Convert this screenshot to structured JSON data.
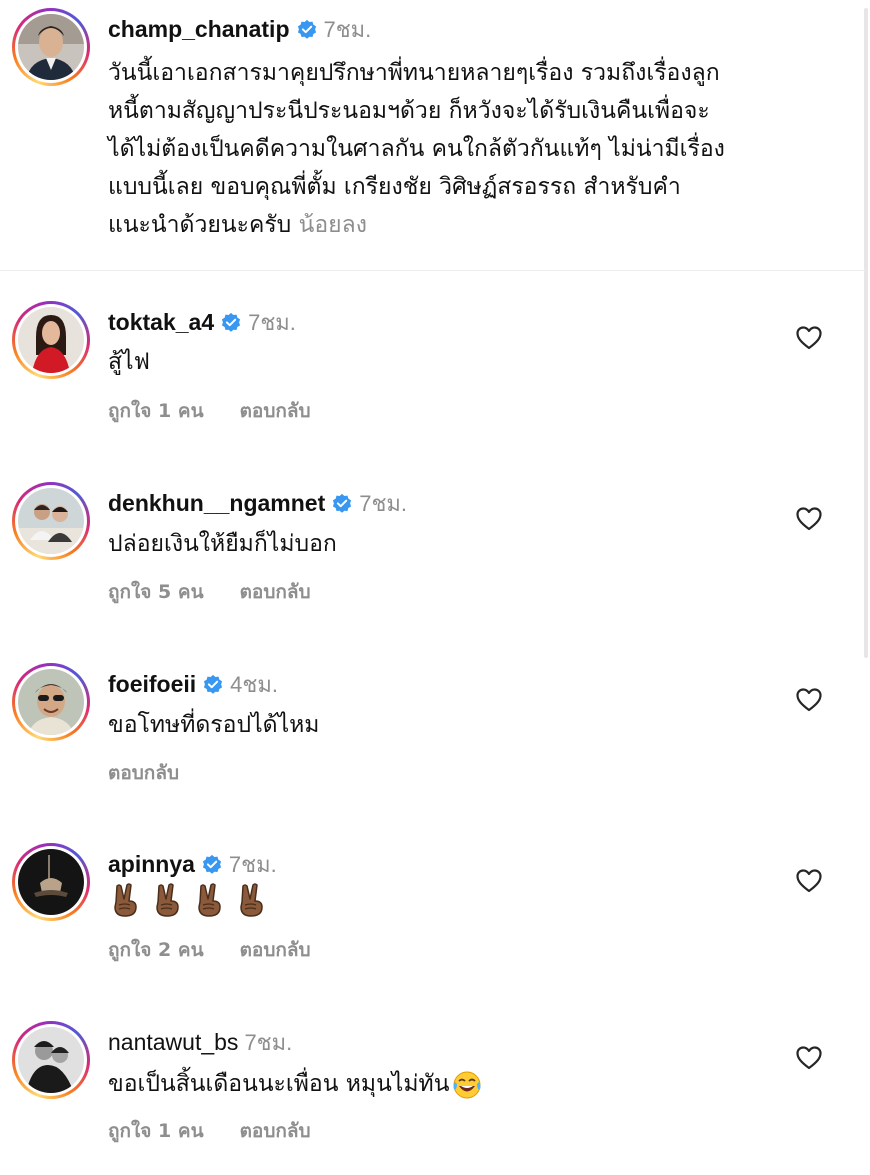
{
  "caption": {
    "username": "champ_chanatip",
    "time": "7ชม.",
    "lines": [
      "วันนี้เอาเอกสารมาคุยปรึกษาพี่ทนายหลายๆเรื่อง รวมถึงเรื่องลูก",
      "หนี้ตามสัญญาประนีประนอมฯด้วย ก็หวังจะได้รับเงินคืนเพื่อจะ",
      "ได้ไม่ต้องเป็นคดีความในศาลกัน คนใกล้ตัวกันแท้ๆ ไม่น่ามีเรื่อง",
      "แบบนี้เลย ขอบคุณพี่ตั้ม เกรียงชัย วิศิษฏ์สรอรรถ สำหรับคำ",
      "แนะนำด้วยนะครับ"
    ],
    "see_less": "น้อยลง"
  },
  "comments": [
    {
      "username": "toktak_a4",
      "time": "7ชม.",
      "text": "สู้ไฟ",
      "likes": "ถูกใจ 1 คน",
      "reply": "ตอบกลับ"
    },
    {
      "username": "denkhun__ngamnet",
      "time": "7ชม.",
      "text": "ปล่อยเงินให้ยืมก็ไม่บอก",
      "likes": "ถูกใจ 5 คน",
      "reply": "ตอบกลับ"
    },
    {
      "username": "foeifoeii",
      "time": "4ชม.",
      "text": "ขอโทษที่ดรอปได้ไหม",
      "likes": "",
      "reply": "ตอบกลับ"
    },
    {
      "username": "apinnya",
      "time": "7ชม.",
      "text": "",
      "emoji": "✌🏾✌🏾✌🏾✌🏾",
      "likes": "ถูกใจ 2 คน",
      "reply": "ตอบกลับ"
    },
    {
      "username": "nantawut_bs",
      "time": "7ชม.",
      "text": "ขอเป็นสิ้นเดือนนะเพื่อน หมุนไม่ทัน",
      "emoji": "😂",
      "likes": "ถูกใจ 1 คน",
      "reply": "ตอบกลับ"
    }
  ],
  "icons": {
    "verified": "verified-badge-icon",
    "heart": "heart-outline-icon"
  },
  "colors": {
    "verified_blue": "#3897f0",
    "secondary_text": "#8e8e8e",
    "primary_text": "#111111"
  }
}
